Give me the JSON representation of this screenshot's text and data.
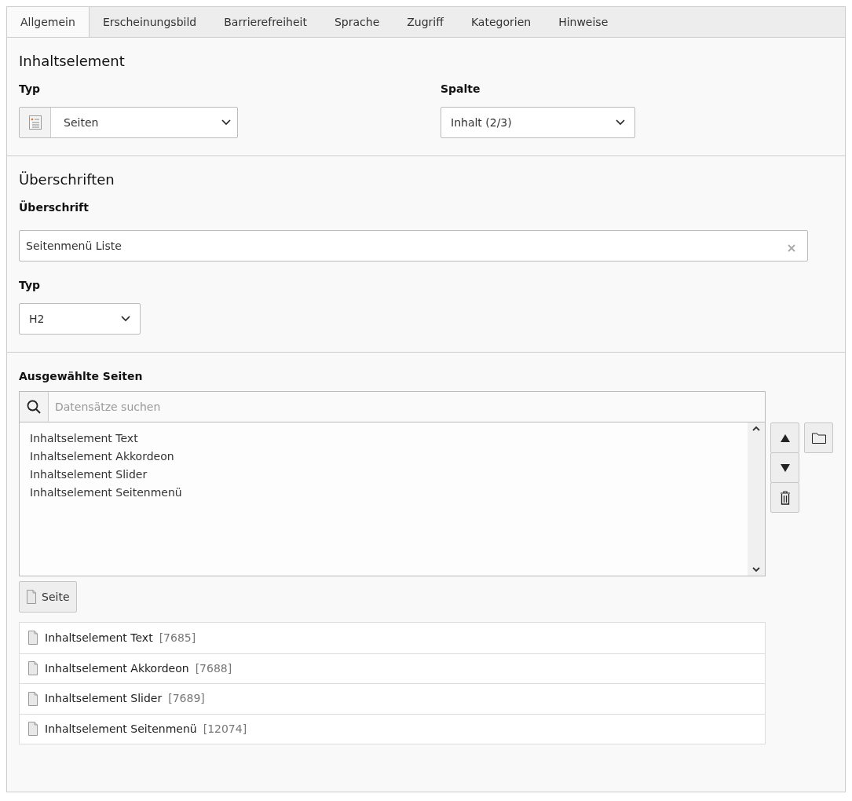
{
  "tabs": [
    {
      "label": "Allgemein",
      "selected": true
    },
    {
      "label": "Erscheinungsbild",
      "selected": false
    },
    {
      "label": "Barrierefreiheit",
      "selected": false
    },
    {
      "label": "Sprache",
      "selected": false
    },
    {
      "label": "Zugriff",
      "selected": false
    },
    {
      "label": "Kategorien",
      "selected": false
    },
    {
      "label": "Hinweise",
      "selected": false
    }
  ],
  "content_element": {
    "heading": "Inhaltselement",
    "type": {
      "label": "Typ",
      "value": "Seiten"
    },
    "column": {
      "label": "Spalte",
      "value": "Inhalt (2/3)"
    }
  },
  "headers": {
    "heading": "Überschriften",
    "header": {
      "label": "Überschrift",
      "value": "Seitenmenü Liste"
    },
    "header_type": {
      "label": "Typ",
      "value": "H2"
    }
  },
  "pages": {
    "label": "Ausgewählte Seiten",
    "search": {
      "placeholder": "Datensätze suchen"
    },
    "selected_items": [
      "Inhaltselement Text",
      "Inhaltselement Akkordeon",
      "Inhaltselement Slider",
      "Inhaltselement Seitenmenü"
    ],
    "add_button": "Seite",
    "records": [
      {
        "title": "Inhaltselement Text",
        "id": "[7685]"
      },
      {
        "title": "Inhaltselement Akkordeon",
        "id": "[7688]"
      },
      {
        "title": "Inhaltselement Slider",
        "id": "[7689]"
      },
      {
        "title": "Inhaltselement Seitenmenü",
        "id": "[12074]"
      }
    ]
  }
}
